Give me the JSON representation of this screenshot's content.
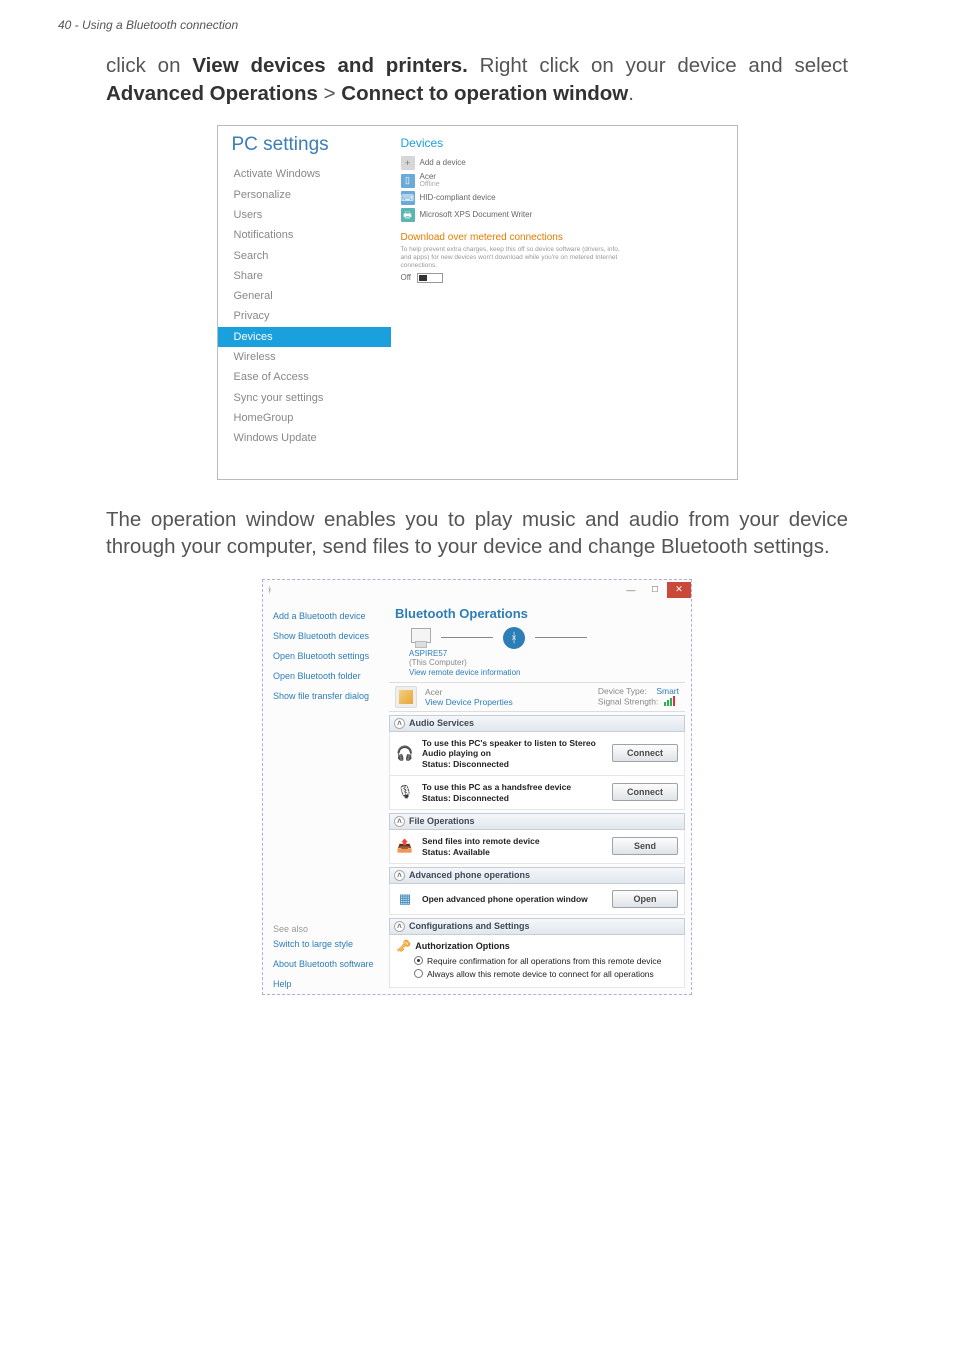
{
  "header": "40 - Using a Bluetooth connection",
  "para1_pre": "click on ",
  "para1_b1": "View devices and printers.",
  "para1_mid": " Right click on your device and select ",
  "para1_b2": "Advanced Operations",
  "para1_gt": " > ",
  "para1_b3": "Connect to operation window",
  "para1_end": ".",
  "para2": "The operation window enables you to play music and audio from your device through your computer, send files to your device and change Bluetooth settings.",
  "pcset": {
    "title": "PC settings",
    "items": [
      "Activate Windows",
      "Personalize",
      "Users",
      "Notifications",
      "Search",
      "Share",
      "General",
      "Privacy",
      "Devices",
      "Wireless",
      "Ease of Access",
      "Sync your settings",
      "HomeGroup",
      "Windows Update"
    ],
    "right": {
      "title": "Devices",
      "addLabel": "Add a device",
      "dev1": "Acer",
      "dev1sub": "Offline",
      "dev2": "HID-compliant device",
      "dev3": "Microsoft XPS Document Writer",
      "dlTitle": "Download over metered connections",
      "dlDesc": "To help prevent extra charges, keep this off so device software (drivers, info, and apps) for new devices won't download while you're on metered Internet connections.",
      "toggle": "Off"
    }
  },
  "bt": {
    "side": {
      "top": [
        "Add a Bluetooth device",
        "Show Bluetooth devices",
        "Open Bluetooth settings",
        "Open Bluetooth folder",
        "Show file transfer dialog"
      ],
      "seeAlso": "See also",
      "bottom": [
        "Switch to large style",
        "About Bluetooth software",
        "Help"
      ]
    },
    "title": "Bluetooth Operations",
    "diag": {
      "pcName": "ASPIRE57",
      "pcRole": "(This Computer)",
      "remoteInfo": "View remote device information"
    },
    "device": {
      "name": "Acer",
      "viewProps": "View Device Properties",
      "typeLabel": "Device Type:",
      "typeVal": "Smart",
      "sigLabel": "Signal Strength:"
    },
    "sections": {
      "audio": "Audio Services",
      "file": "File Operations",
      "adv": "Advanced phone operations",
      "conf": "Configurations and Settings"
    },
    "svc": {
      "stereo": "To use this PC's speaker to listen to Stereo Audio playing on",
      "stereoStatus": "Status:  Disconnected",
      "handsfree": "To use this PC as a handsfree device",
      "handsfreeStatus": "Status:  Disconnected",
      "sendfiles": "Send files into remote device",
      "sendfilesStatus": "Status:  Available",
      "advphone": "Open advanced phone operation window"
    },
    "btn": {
      "connect": "Connect",
      "send": "Send",
      "open": "Open"
    },
    "auth": {
      "title": "Authorization Options",
      "opt1": "Require confirmation for all operations from this remote device",
      "opt2": "Always allow this remote device to connect for all operations"
    }
  }
}
